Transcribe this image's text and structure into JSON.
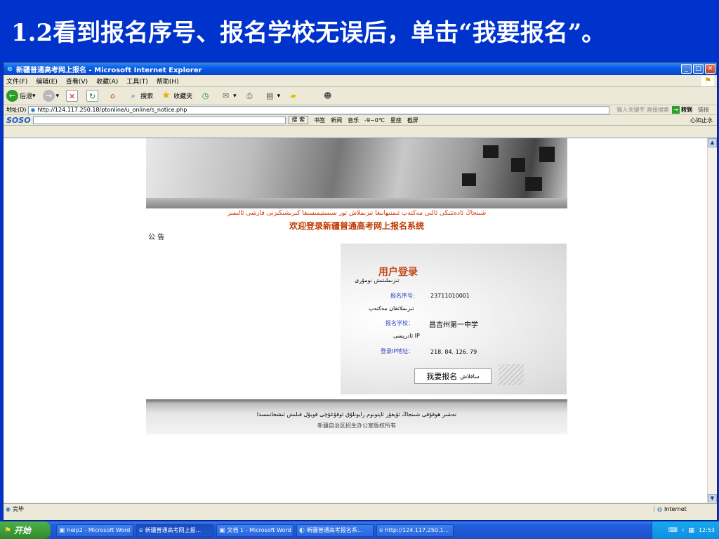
{
  "slide": {
    "title": "1.2看到报名序号、报名学校无误后，单击“我要报名”。"
  },
  "window": {
    "title": "新疆普通高考网上报名 - Microsoft Internet Explorer"
  },
  "menu": [
    "文件(F)",
    "编辑(E)",
    "查看(V)",
    "收藏(A)",
    "工具(T)",
    "帮助(H)"
  ],
  "toolbar": {
    "back": "后退",
    "search": "搜索",
    "favorites": "收藏夹"
  },
  "address": {
    "label": "地址(D)",
    "url": "http://124.117.250.18/ptonline/u_online/s_notice.php",
    "search_hint": "输入关键字 直接搜索",
    "go": "转到",
    "links": "链接"
  },
  "soso": {
    "logo": "SOSO",
    "search_button": "搜 索",
    "items": [
      "书签",
      "新闻",
      "音乐",
      "-9~0℃",
      "星座",
      "截屏"
    ],
    "right_item": "心如止水"
  },
  "page": {
    "uyghur_welcome": "شىنجاڭ ئادەتتىكى ئالىي مەكتەپ ئىمتىھانىغا تىزىملاش تور سىستېمىسىغا كىرىشىڭىزنى قارشى ئالىمىز",
    "welcome": "欢迎登录新疆普通高考网上报名系统",
    "notice": "公 告"
  },
  "login": {
    "title": "用户登录",
    "title_ug": "تىزىملىتىش نومۇرى",
    "reg_label_ug": "تىزىملاتقان مەكتەپ",
    "reg_label": "报名序号:",
    "reg_value": "23711010001",
    "school_label_ug": "IP ئادرېسى",
    "school_label": "报名学校：",
    "school_value": "昌吉州第一中学",
    "ip_label": "登录IP地址：",
    "ip_value": "218. 84. 126. 79",
    "register_button": "我要报名",
    "register_button_ug": "ساقلاش"
  },
  "footer": {
    "uyghur": "نەشىر ھوقۇقى شىنجاڭ ئۇيغۇر ئاپتونوم رايونلۇق ئوقۇغۇچى قوبۇل قىلىش ئىشخانىسىدا",
    "copyright": "新疆自治区招生办公室版权所有"
  },
  "status": {
    "text": "完毕",
    "zone": "Internet"
  },
  "taskbar": {
    "start": "开始",
    "tasks": [
      "help2 - Microsoft Word",
      "新疆普通高考网上报...",
      "文档 1 - Microsoft Word",
      "新疆普通高考报名系...",
      "http://124.117.250.1..."
    ],
    "clock": "12:53"
  }
}
